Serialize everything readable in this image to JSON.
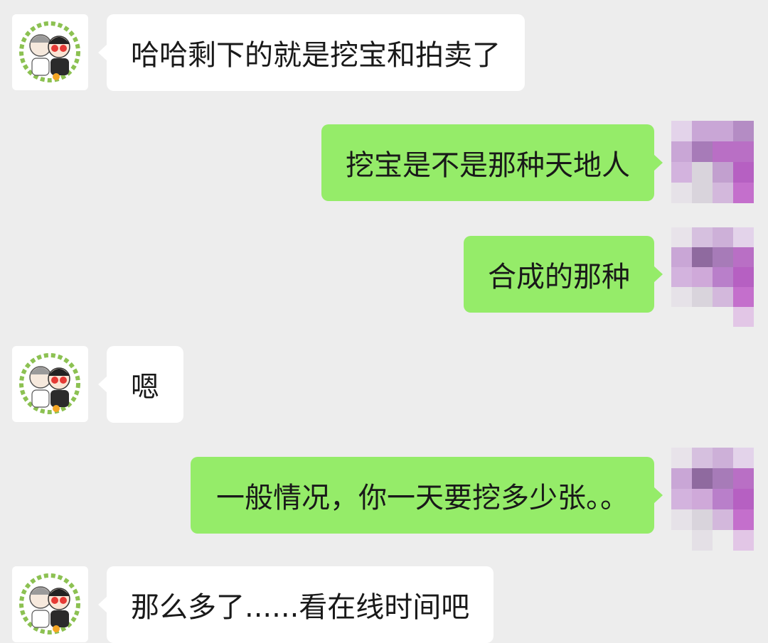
{
  "chat": {
    "messages": [
      {
        "side": "in",
        "text": "哈哈剩下的就是挖宝和拍卖了"
      },
      {
        "side": "out",
        "text": "挖宝是不是那种天地人"
      },
      {
        "side": "out",
        "text": "合成的那种"
      },
      {
        "side": "in",
        "text": "嗯"
      },
      {
        "side": "out",
        "text": "一般情况，你一天要挖多少张。。"
      },
      {
        "side": "in",
        "text": "那么多了......看在线时间吧"
      }
    ]
  },
  "avatars": {
    "left_icon": "cartoon-couple-avatar-icon",
    "right_icon": "pixelated-avatar-icon"
  },
  "colors": {
    "background": "#ededed",
    "incoming_bubble": "#ffffff",
    "outgoing_bubble": "#95ec69",
    "text": "#191919",
    "mosaic_palette": [
      "#c9a6d6",
      "#a77bb8",
      "#b96fc5",
      "#e3d3ea",
      "#d9d4dc",
      "#8f6a9f",
      "#c2c0c4",
      "#d39bd9"
    ]
  }
}
